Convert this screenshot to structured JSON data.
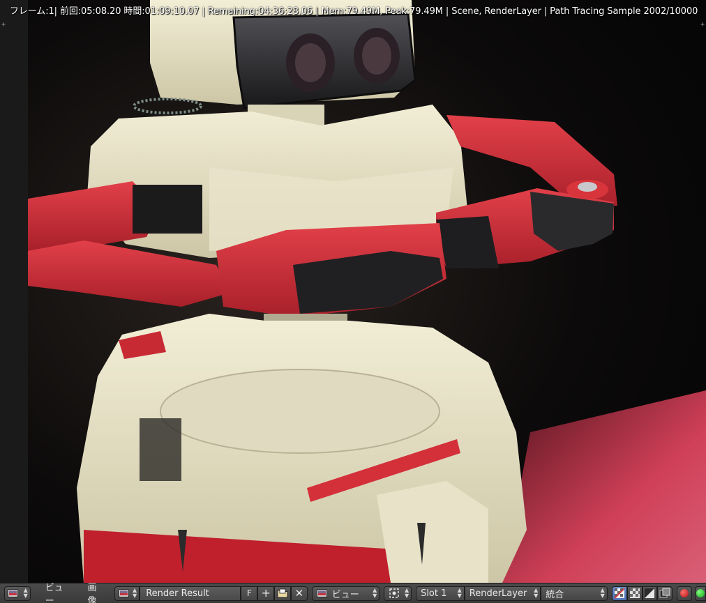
{
  "viewport": {
    "status_line": "フレーム:1| 前回:05:08.20 時間:01:09:10.07 | Remaining:04:36:28.06 | Mem:79.49M, Peak:79.49M | Scene, RenderLayer | Path Tracing Sample 2002/10000"
  },
  "header": {
    "editor_type_icon": "image-editor-icon",
    "menus": [
      "ビュー",
      "画像"
    ],
    "image_name": "Render Result",
    "fake_user_label": "F",
    "view_dropdown": "ビュー",
    "slot_dropdown": "Slot 1",
    "layer_dropdown": "RenderLayer",
    "pass_dropdown": "統合"
  },
  "colors": {
    "header_bg": "#434343",
    "accent": "#5680c2",
    "robot_red": "#c9262f",
    "robot_white": "#e8e2c6"
  }
}
